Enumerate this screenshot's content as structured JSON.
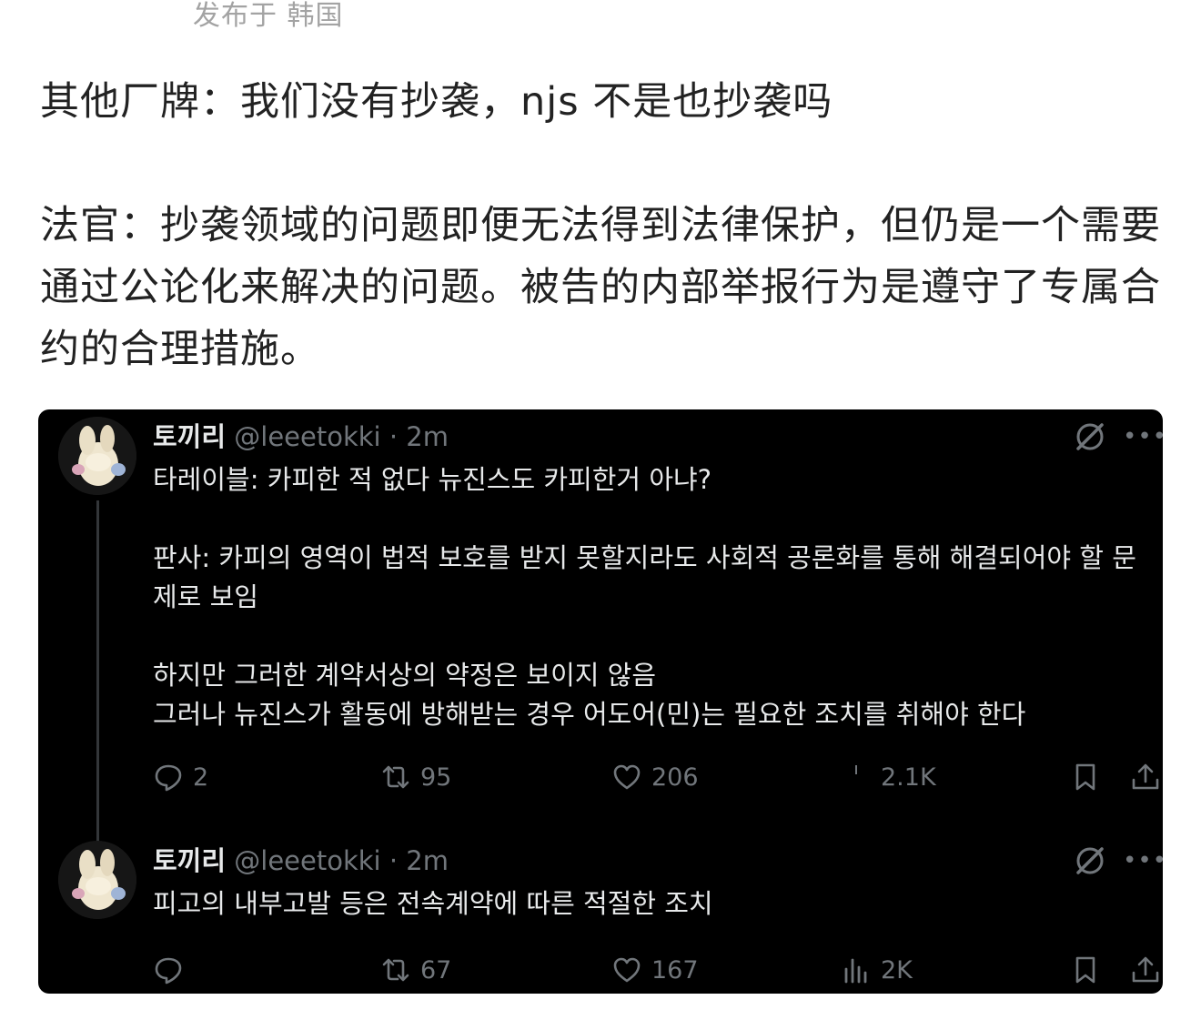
{
  "post": {
    "meta": "发布于 韩国",
    "line1": "其他厂牌：我们没有抄袭，njs 不是也抄袭吗",
    "paragraph2": "法官：抄袭领域的问题即便无法得到法律保护，但仍是一个需要通过公论化来解决的问题。被告的内部举报行为是遵守了专属合约的合理措施。"
  },
  "embed": {
    "tweets": [
      {
        "name": "토끼리",
        "handle": "@leeetokki",
        "sep": "·",
        "time": "2m",
        "lines": [
          "타레이블: 카피한 적 없다 뉴진스도 카피한거 아냐?",
          "",
          "판사: 카피의 영역이 법적 보호를 받지 못할지라도 사회적 공론화를 통해 해결되어야 할 문제로 보임",
          "",
          "하지만 그러한 계약서상의 약정은 보이지 않음",
          "그러나 뉴진스가 활동에 방해받는 경우 어도어(민)는 필요한 조치를 취해야 한다"
        ],
        "reply_count": "2",
        "repost_count": "95",
        "like_count": "206",
        "view_count": "2.1K"
      },
      {
        "name": "토끼리",
        "handle": "@leeetokki",
        "sep": "·",
        "time": "2m",
        "lines": [
          "피고의 내부고발 등은 전속계약에 따른 적절한 조치"
        ],
        "reply_count": "",
        "repost_count": "67",
        "like_count": "167",
        "view_count": "2K"
      }
    ],
    "icons": [
      "reply-icon",
      "repost-icon",
      "like-icon",
      "views-icon",
      "bookmark-icon",
      "share-icon",
      "grok-icon",
      "more-icon"
    ],
    "colors": {
      "background": "#000000",
      "text": "#e7e9ea",
      "muted": "#71767b",
      "page_text": "#222222",
      "meta_text": "#a3a3a3"
    }
  }
}
